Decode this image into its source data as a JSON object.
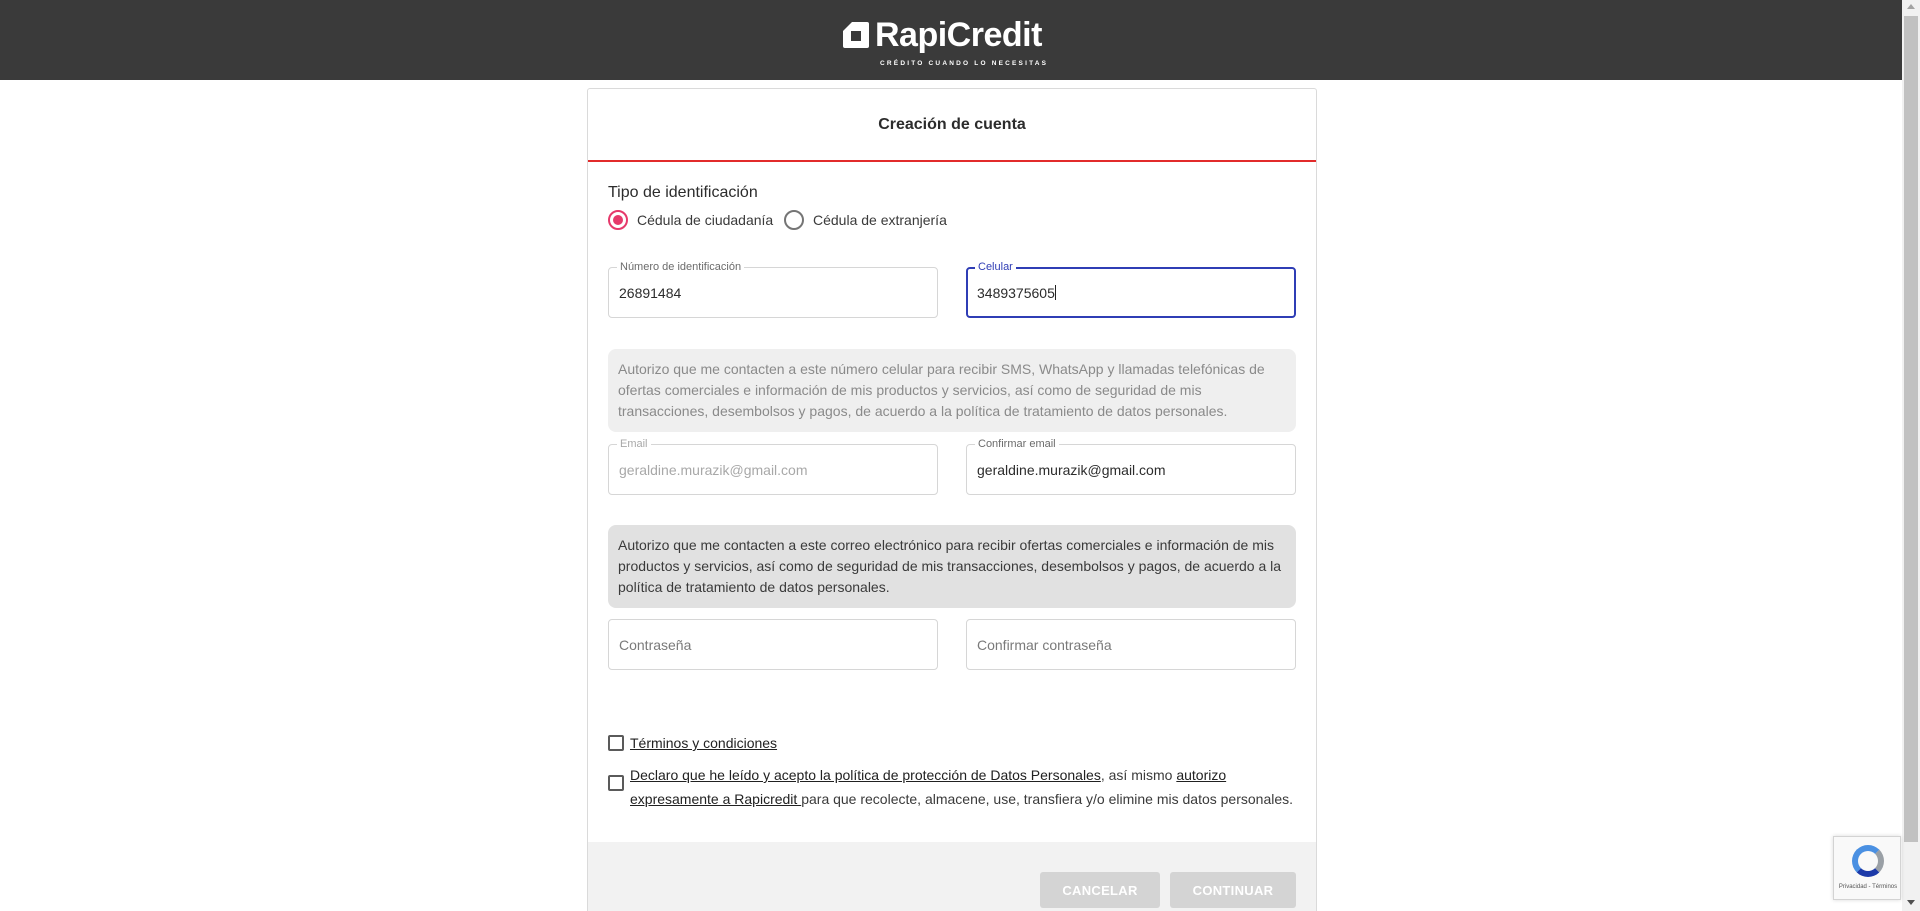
{
  "header": {
    "brand": "RapiCredit",
    "tagline": "CRÉDITO CUANDO LO NECESITAS",
    "background": "#3a3a3a"
  },
  "form": {
    "title": "Creación de cuenta",
    "id_type": {
      "label": "Tipo de identificación",
      "options": [
        {
          "label": "Cédula de ciudadanía",
          "selected": true
        },
        {
          "label": "Cédula de extranjería",
          "selected": false
        }
      ]
    },
    "fields": {
      "id_number": {
        "label": "Número de identificación",
        "value": "26891484"
      },
      "phone": {
        "label": "Celular",
        "value": "3489375605"
      },
      "email": {
        "label": "Email",
        "value": "geraldine.murazik@gmail.com"
      },
      "confirm_email": {
        "label": "Confirmar email",
        "value": "geraldine.murazik@gmail.com"
      },
      "password": {
        "placeholder": "Contraseña"
      },
      "confirm_password": {
        "placeholder": "Confirmar contraseña"
      }
    },
    "phone_notice": "Autorizo que me contacten a este número celular para recibir SMS, WhatsApp y llamadas telefónicas de ofertas comerciales e información de mis productos y servicios, así como de seguridad de mis transacciones, desembolsos y pagos, de acuerdo a la política de tratamiento de datos personales.",
    "email_notice": "Autorizo que me contacten a este correo electrónico para recibir ofertas comerciales e información de mis productos y servicios, así como de seguridad de mis transacciones, desembolsos y pagos, de acuerdo a la política de tratamiento de datos personales.",
    "terms": {
      "link": " Términos y condiciones "
    },
    "privacy": {
      "link1": " Declaro que he leído y acepto la política de protección de Datos Personales",
      "text1": ", así mismo ",
      "link2": "autorizo expresamente a Rapicredit ",
      "text2": "para que recolecte, almacene, use, transfiera y/o elimine mis datos personales."
    },
    "buttons": {
      "cancel": "CANCELAR",
      "continue": "CONTINUAR"
    }
  },
  "recaptcha": {
    "footer": "Privacidad - Términos"
  },
  "colors": {
    "accent_red": "#e22b2b",
    "radio_pink": "#e6396b",
    "focus_blue": "#2f3db5"
  }
}
